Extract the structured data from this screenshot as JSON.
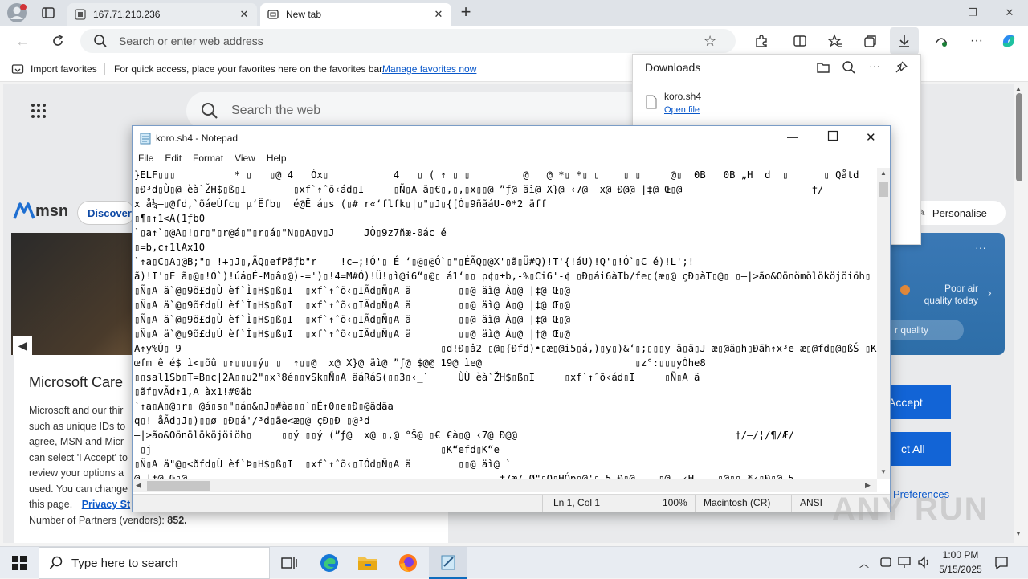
{
  "browser": {
    "tabs": [
      {
        "label": "167.71.210.236"
      },
      {
        "label": "New tab"
      }
    ],
    "address_placeholder": "Search or enter web address",
    "favorites_bar": {
      "import_label": "Import favorites",
      "message": "For quick access, place your favorites here on the favorites bar.",
      "manage_link": "Manage favorites now"
    }
  },
  "newtab": {
    "search_placeholder": "Search the web",
    "msn_logo": "msn",
    "discover_label": "Discover",
    "personalise_label": "Personalise",
    "weather_text": "Poor air quality today",
    "air_quality_label": "r quality",
    "consent": {
      "title": "Microsoft Care",
      "body_lines": [
        "Microsoft and our thir",
        "such as unique IDs to",
        "agree, MSN and Micr",
        "can select 'I Accept' to",
        "review your options a",
        "used. You can change"
      ],
      "this_page": "this page.",
      "privacy_link": "Privacy St",
      "partners_label": "Number of Partners (vendors):",
      "partners_count": "852.",
      "accept_button": "Accept",
      "reject_button": "ct All",
      "preferences_link": "Preferences"
    }
  },
  "downloads": {
    "title": "Downloads",
    "file_name": "koro.sh4",
    "open_file_link": "Open file"
  },
  "notepad": {
    "title": "koro.sh4 - Notepad",
    "menu": [
      "File",
      "Edit",
      "Format",
      "View",
      "Help"
    ],
    "lines": [
      "}ELF\u0001\u0001\u0001          * \u0001   \u0001@ 4   Óx\u0001           4   \u0001 ( ↑ \u0001 \u0001         @   @ *\u0001 *\u0001 \u0001    \u0001 \u0001     @\u0001  0B   0B „H  d  \u0001      \u0001 Qåtd",
      "\u0001Ð³d\u0001Ù\u0001@ èà`ŽH$\u0001ß\u0001I        \u0001xf`↑ˆõ‹ád\u0001I     \u0001Ñ\u0001A ä\u0001€\u0001,\u0001,\u0001x\u0001\u0001@ ”ƒ@ äì@ X}@ ‹7@  x@ Ð@@ |‡@ Œ\u0001@                      †/",
      "x å¼–\u0001@fd,`õáeÚfc\u0001 µ‘Ëfb\u0001  é@Ë á\u0001s (\u0001# r«‘flfk\u0001|\u0001\"\u0001J\u0001{[Ò\u00019ñãáU-0*2 äff",
      "\u0001¶\u0001↑1<A(1ƒb0",
      "`\u0001a↑`\u0001@A\u0001!\u0001r\u0001\"\u0001r@á\u0001\"\u0001r\u0001á\u0001\"N\u0001\u0001A\u0001v\u0001J     JÒ\u00019z7ñæ-0ác é",
      "\u0001=b,c↑1lAx10",
      "`↑a\u0001C\u0001A\u0001@B;\"\u0001 !+\u0001J\u0001,ÃQ\u0001efPãƒb\"r    !c–;!Ó'\u0001 É_‘\u0001@\u0001@Ó`\u0001\"\u0001ÉÃQ\u0001@X'\u0001ã\u0001Ü#Q)!T'{!áU)!Q'\u0001!Ó`\u0001C é)!L';!",
      "ã)!I'\u0001É ã\u0001@\u0001!Ó`)!úá\u0001É-M\u0001â\u0001@)-=')\u0001!4=M#Ó)!Ü!\u0001ì@i6“\u0001@\u0001 á1‘\u0001\u0001 p¢\u0001±b,-%\u0001Ci6'-¢ \u0001Ð\u0001ái6àTb/fe\u0001(æ\u0001@ çÐ\u0001àT\u0001@\u0001 \u0001–|>ão&Oönömölököjöiöh\u0001",
      "\u0001Ñ\u0001A ä`@\u00019õ£d\u0001Ù èf`Ì\u0001H$\u0001ß\u0001I  \u0001xf`↑ˆõ‹\u0001IÃd\u0001Ñ\u0001A ä        \u0001\u0001@ äì@ À\u0001@ |‡@ Œ\u0001@",
      "\u0001Ñ\u0001A ä`@\u00019õ£d\u0001Ù èf`Ì\u0001H$\u0001ß\u0001I  \u0001xf`↑ˆõ‹\u0001IÃd\u0001Ñ\u0001A ä        \u0001\u0001@ äì@ À\u0001@ |‡@ Œ\u0001@",
      "\u0001Ñ\u0001A ä`@\u00019õ£d\u0001Ù èf`Ì\u0001H$\u0001ß\u0001I  \u0001xf`↑ˆõ‹\u0001IÃd\u0001Ñ\u0001A ä        \u0001\u0001@ äì@ À\u0001@ |‡@ Œ\u0001@",
      "\u0001Ñ\u0001A ä`@\u00019õ£d\u0001Ù èf`Ì\u0001H$\u0001ß\u0001I  \u0001xf`↑ˆõ‹\u0001IÃd\u0001Ñ\u0001A ä        \u0001\u0001@ äì@ À\u0001@ |‡@ Œ\u0001@",
      "A↑y%Ú\u0001 9                                            \u0001d!Ð\u0001â2–\u0001@\u0001{Ðfd)•\u0001æ\u0001@i5\u0001á,)\u0001y\u0001)&‘\u0001;\u0001\u0001\u0001y ä\u0001ã\u0001J æ\u0001@ã\u0001h\u0001Ðãh↑x³e æ\u0001@fd\u0001@\u0001ßŠ \u0001K\u0001K\u0001",
      "œfm ê é$ ì<\u0001õû \u0001↑\u0001\u0001\u0001\u0001ý\u0001 \u0001  ↑\u0001\u0001@  x@ X}@ äì@ ”ƒ@ $@@ 19@ ìe@                          \u0001z°:\u0001\u0001\u0001yÓhe8",
      "\u0001\u0001sal1Sb\u0001T=B\u0001c|2A\u0001\u0001u2\"\u0001x³8é\u0001\u0001vSk\u0001Ñ\u0001A äáRáS(\u0001\u00013\u0001‹_`     ÙÙ èà`ŽH$\u0001ß\u0001I     \u0001xf`↑ˆõ‹ád\u0001I     \u0001Ñ\u0001A ä",
      "\u0001ãf\u0001vÃd↑1,A àx1!#0ãb",
      "`↑a\u0001A\u0001@\u0001r\u0001 @á\u0001s\u0001\"\u0001á\u0001&\u0001J\u0001#àa\u0001\u0001`\u0001É↑0\u0001e\u0001Ð\u0001@ãdãa",
      "q\u0001! åÃd\u0001J\u0001)\u0001\u0001ø \u0001Ð\u0001á'/³d\u0001ãe<æ\u0001@ çÐ\u0001Ð \u0001@³d",
      "–|>ão&Oönölököjöiöh\u0001     \u0001\u0001ý \u0001\u0001ý (”ƒ@  x@ \u0001,@ °Š@ \u0001€ €à\u0001@ ‹7@ Ð@@                                     †/–/¦/¶/Æ/",
      " \u0001j                                                 \u0001K“efd\u0001K“e",
      "\u0001Ñ\u0001A ä\"@\u0001<ðfd\u0001Ù èf`Þ\u0001H$\u0001ß\u0001I  \u0001xf`↑ˆõ‹\u0001IÓd\u0001Ñ\u0001A ä        \u0001\u0001@ äì@ `",
      "@ |‡@ Œ\u0001@                                                     †/æ/ Ø\"\u0001O\u0001HÓp\u0001@'\u0001 5 Ð\u0001@    \u0001@  ‹H    \u0001@\u0001\u0001 *‹\u0001Ð\u0001@ 5"
    ],
    "status": {
      "position": "Ln 1, Col 1",
      "zoom": "100%",
      "line_endings": "Macintosh (CR)",
      "encoding": "ANSI"
    }
  },
  "taskbar": {
    "search_placeholder": "Type here to search",
    "time": "1:00 PM",
    "date": "5/15/2025"
  },
  "watermark": "ANY RUN",
  "colors": {
    "accent": "#0f6cbd",
    "link": "#0a58ca",
    "consent_button": "#1264d6",
    "weather_panel": "#2d6ea8"
  }
}
